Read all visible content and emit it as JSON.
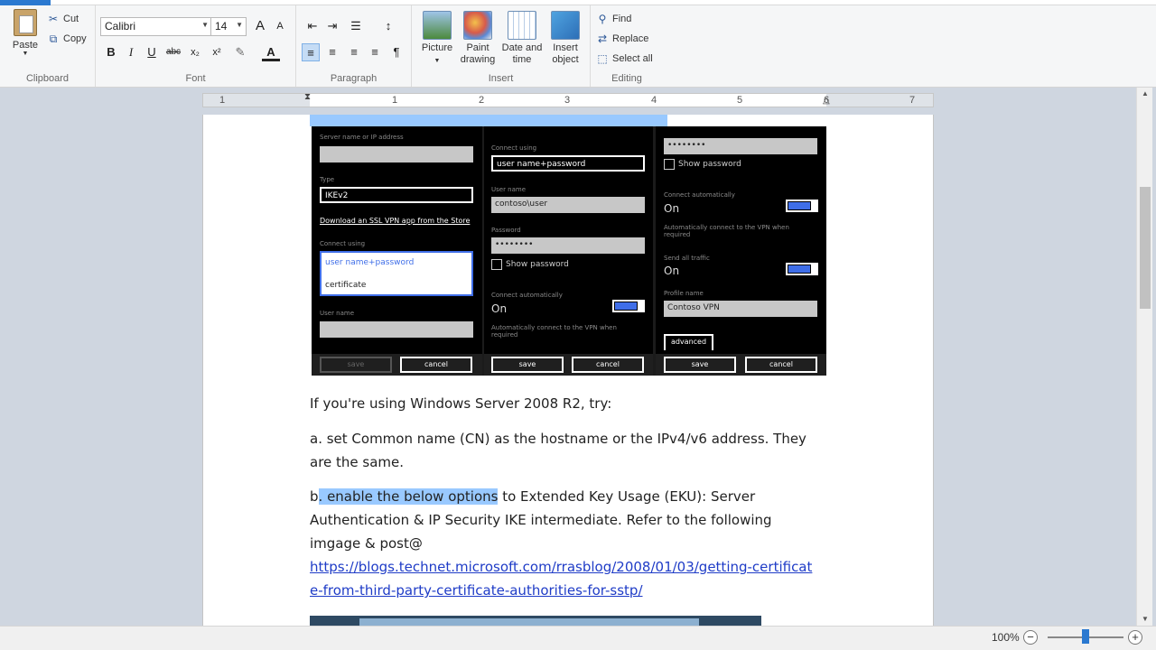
{
  "clipboard": {
    "paste": "Paste",
    "cut": "Cut",
    "copy": "Copy",
    "label": "Clipboard"
  },
  "font": {
    "family": "Calibri",
    "size": "14",
    "label": "Font",
    "bold": "B",
    "italic": "I",
    "underline": "U",
    "strike": "abc",
    "subscript": "x₂",
    "superscript": "x²",
    "grow": "A",
    "shrink": "A"
  },
  "paragraph": {
    "label": "Paragraph"
  },
  "insert": {
    "label": "Insert",
    "picture": "Picture",
    "paint": "Paint drawing",
    "datetime": "Date and time",
    "object": "Insert object"
  },
  "editing": {
    "label": "Editing",
    "find": "Find",
    "replace": "Replace",
    "select_all": "Select all"
  },
  "ruler": {
    "numbers": [
      "1",
      "1",
      "2",
      "3",
      "4",
      "5",
      "6",
      "7"
    ]
  },
  "phone1": {
    "server_label": "Server name or IP address",
    "type_label": "Type",
    "type_value": "IKEv2",
    "link": "Download an SSL VPN app from the Store",
    "connect_label": "Connect using",
    "option_1": "user name+password",
    "option_2": "certificate",
    "user_label": "User name",
    "save": "save",
    "cancel": "cancel"
  },
  "phone2": {
    "connect_label": "Connect using",
    "connect_value": "user name+password",
    "user_label": "User name",
    "user_value": "contoso\\user",
    "password_label": "Password",
    "password_value": "••••••••",
    "show_password": "Show password",
    "auto_label": "Connect automatically",
    "on": "On",
    "auto_note": "Automatically connect to the VPN when required",
    "save": "save",
    "cancel": "cancel"
  },
  "phone3": {
    "password_value": "••••••••",
    "show_password": "Show password",
    "auto_label": "Connect automatically",
    "on_1": "On",
    "auto_note": "Automatically connect to the VPN when required",
    "send_label": "Send all traffic",
    "on_2": "On",
    "profile_label": "Profile name",
    "profile_value": "Contoso VPN",
    "advanced": "advanced",
    "save": "save",
    "cancel": "cancel"
  },
  "doc": {
    "p1": "If you're using Windows Server 2008 R2, try:",
    "p2": "a. set Common name (CN) as the hostname or the IPv4/v6 address. They are the same.",
    "p3_prefix": "b",
    "p3_selected": ". enable the below options",
    "p3_rest": " to Extended Key Usage (EKU): Server Authentication & IP Security IKE intermediate. Refer to the following imgage & post@",
    "link": "https://blogs.technet.microsoft.com/rrasblog/2008/01/03/getting-certificate-from-third-party-certificate-authorities-for-sstp/"
  },
  "status": {
    "zoom": "100%"
  }
}
